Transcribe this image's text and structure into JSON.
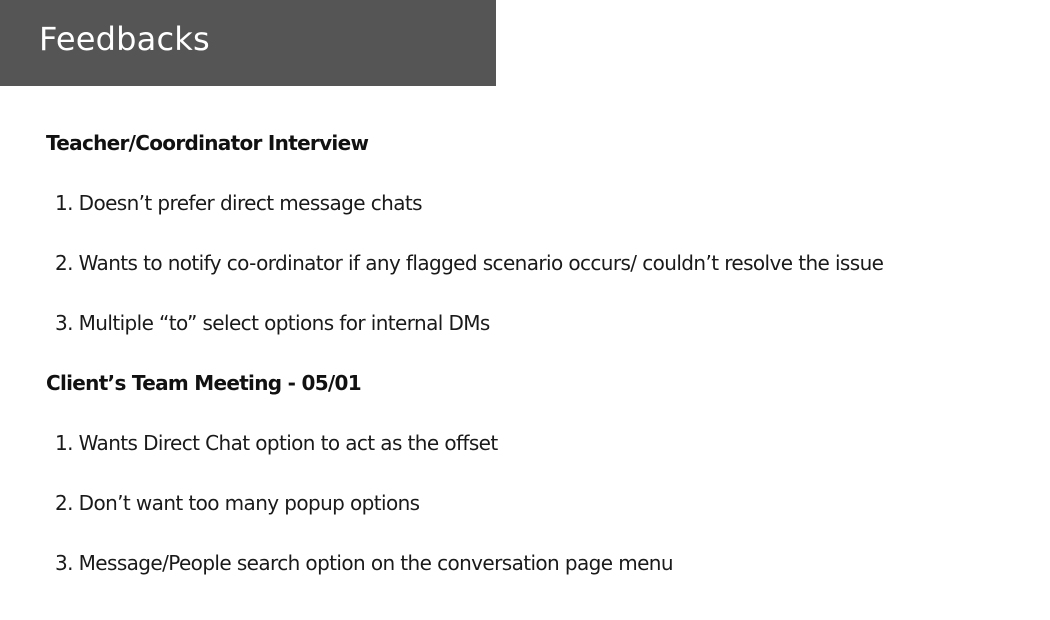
{
  "header": {
    "title": "Feedbacks"
  },
  "sections": [
    {
      "title": "Teacher/Coordinator Interview",
      "items": [
        "1. Doesn’t prefer direct message chats",
        "2. Wants to notify co-ordinator if any flagged scenario occurs/ couldn’t resolve the issue",
        "3. Multiple “to” select options for internal DMs"
      ]
    },
    {
      "title": "Client’s Team Meeting - 05/01",
      "items": [
        "1. Wants Direct Chat option to act as the offset",
        "2. Don’t want too many popup options",
        "3. Message/People search option on the conversation page menu"
      ]
    }
  ]
}
